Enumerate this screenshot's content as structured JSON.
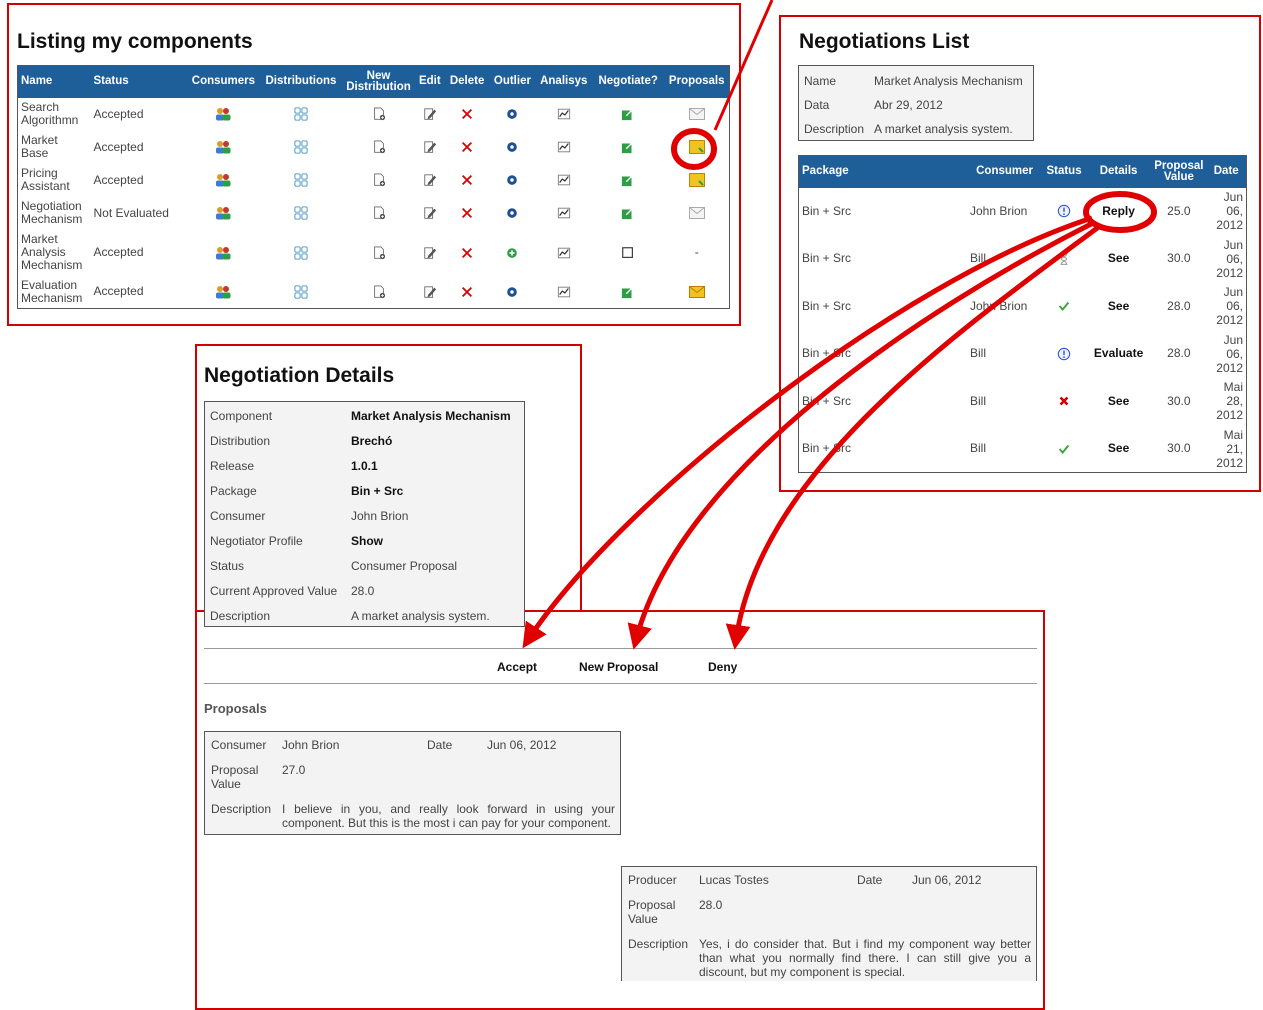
{
  "listing": {
    "title": "Listing my components",
    "headers": [
      "Name",
      "Status",
      "Consumers",
      "Distributions",
      "New Distribution",
      "Edit",
      "Delete",
      "Outlier",
      "Analisys",
      "Negotiate?",
      "Proposals"
    ],
    "rows": [
      {
        "name": "Search Algorithmn",
        "status": "Accepted",
        "outlier": "dot",
        "negotiate": "icon",
        "proposal": "mail"
      },
      {
        "name": "Market Base",
        "status": "Accepted",
        "outlier": "dot",
        "negotiate": "icon",
        "proposal": "new"
      },
      {
        "name": "Pricing Assistant",
        "status": "Accepted",
        "outlier": "dot",
        "negotiate": "icon",
        "proposal": "new"
      },
      {
        "name": "Negotiation Mechanism",
        "status": "Not Evaluated",
        "outlier": "dot",
        "negotiate": "icon",
        "proposal": "mail"
      },
      {
        "name": "Market Analysis Mechanism",
        "status": "Accepted",
        "outlier": "plus",
        "negotiate": "checkbox",
        "proposal": "-"
      },
      {
        "name": "Evaluation Mechanism",
        "status": "Accepted",
        "outlier": "dot",
        "negotiate": "icon",
        "proposal": "envelope"
      }
    ]
  },
  "negotiations": {
    "title": "Negotiations List",
    "info": {
      "name_label": "Name",
      "name": "Market Analysis Mechanism",
      "data_label": "Data",
      "data": "Abr 29, 2012",
      "desc_label": "Description",
      "desc": "A market analysis system."
    },
    "headers": [
      "Package",
      "Consumer",
      "Status",
      "Details",
      "Proposal Value",
      "Date"
    ],
    "rows": [
      {
        "package": "Bin + Src",
        "consumer": "John Brion",
        "status": "pending",
        "details": "Reply",
        "value": "25.0",
        "date": "Jun 06, 2012"
      },
      {
        "package": "Bin + Src",
        "consumer": "Bill",
        "status": "waiting",
        "details": "See",
        "value": "30.0",
        "date": "Jun 06, 2012"
      },
      {
        "package": "Bin + Src",
        "consumer": "John Brion",
        "status": "accepted",
        "details": "See",
        "value": "28.0",
        "date": "Jun 06, 2012"
      },
      {
        "package": "Bin + Src",
        "consumer": "Bill",
        "status": "pending",
        "details": "Evaluate",
        "value": "28.0",
        "date": "Jun 06, 2012"
      },
      {
        "package": "Bin + Src",
        "consumer": "Bill",
        "status": "denied",
        "details": "See",
        "value": "30.0",
        "date": "Mai 28, 2012"
      },
      {
        "package": "Bin + Src",
        "consumer": "Bill",
        "status": "accepted",
        "details": "See",
        "value": "30.0",
        "date": "Mai 21, 2012"
      }
    ]
  },
  "details": {
    "title": "Negotiation Details",
    "fields": [
      {
        "label": "Component",
        "value": "Market Analysis Mechanism",
        "bold": true
      },
      {
        "label": "Distribution",
        "value": "Brechó",
        "bold": true
      },
      {
        "label": "Release",
        "value": "1.0.1",
        "bold": true
      },
      {
        "label": "Package",
        "value": "Bin + Src",
        "bold": true
      },
      {
        "label": "Consumer",
        "value": "John Brion",
        "bold": false
      },
      {
        "label": "Negotiator Profile",
        "value": "Show",
        "bold": true
      },
      {
        "label": "Status",
        "value": "Consumer Proposal",
        "bold": false
      },
      {
        "label": "Current Approved Value",
        "value": "28.0",
        "bold": false
      },
      {
        "label": "Description",
        "value": "A market analysis system.",
        "bold": false
      }
    ],
    "actions": {
      "accept": "Accept",
      "new_proposal": "New Proposal",
      "deny": "Deny"
    },
    "proposals_title": "Proposals",
    "proposal1": {
      "party_label": "Consumer",
      "party": "John Brion",
      "date_label": "Date",
      "date": "Jun 06, 2012",
      "value_label": "Proposal Value",
      "value": "27.0",
      "desc_label": "Description",
      "desc": "I believe in you, and really look forward in using your component. But this is the most i can pay for your component."
    },
    "proposal2": {
      "party_label": "Producer",
      "party": "Lucas Tostes",
      "date_label": "Date",
      "date": "Jun 06, 2012",
      "value_label": "Proposal Value",
      "value": "28.0",
      "desc_label": "Description",
      "desc": "Yes, i do consider that. But i find my component way better than what you normally find there. I can still give you a discount, but my component is special."
    }
  },
  "colors": {
    "frame": "#d40000",
    "header": "#1e5f9a",
    "arrow": "#e00000"
  }
}
